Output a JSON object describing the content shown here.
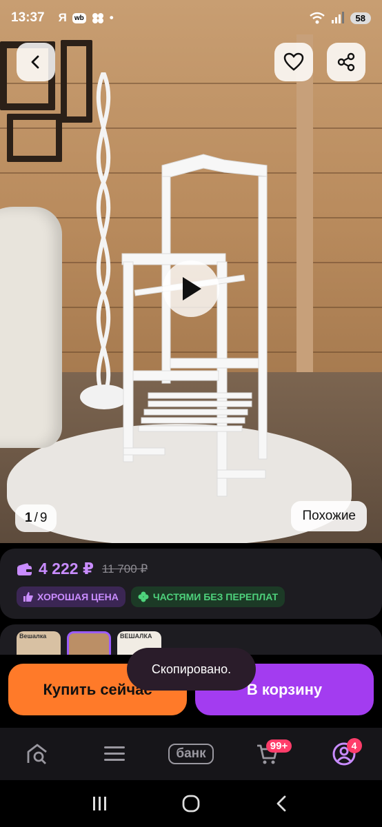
{
  "status_bar": {
    "time": "13:37",
    "left_icons": [
      "Я",
      "wb",
      "•"
    ],
    "battery": "58"
  },
  "gallery": {
    "current": "1",
    "separator": "/",
    "total": "9",
    "similar_label": "Похожие"
  },
  "price": {
    "current": "4 222 ₽",
    "old": "11 700 ₽",
    "accent_color": "#c98cff"
  },
  "badges": {
    "good_price": "ХОРОШАЯ ЦЕНА",
    "installments": "ЧАСТЯМИ БЕЗ ПЕРЕПЛАТ"
  },
  "thumbnails": [
    {
      "text": "Вешалка"
    },
    {
      "text": ""
    },
    {
      "text": "ВЕШАЛКА"
    }
  ],
  "actions": {
    "buy_now": "Купить сейчас",
    "to_cart": "В корзину",
    "buy_color": "#ff7a29",
    "cart_color": "#a33cf0"
  },
  "toast": "Скопировано.",
  "nav": {
    "bank_label": "банк",
    "cart_count": "99+",
    "profile_count": "4"
  },
  "icons": [
    "back-icon",
    "heart-icon",
    "share-icon",
    "play-icon",
    "wallet-icon",
    "thumbs-up-icon",
    "clover-icon",
    "home-search-icon",
    "menu-icon",
    "cart-icon",
    "profile-icon",
    "recent-apps-icon",
    "home-icon",
    "system-back-icon"
  ]
}
